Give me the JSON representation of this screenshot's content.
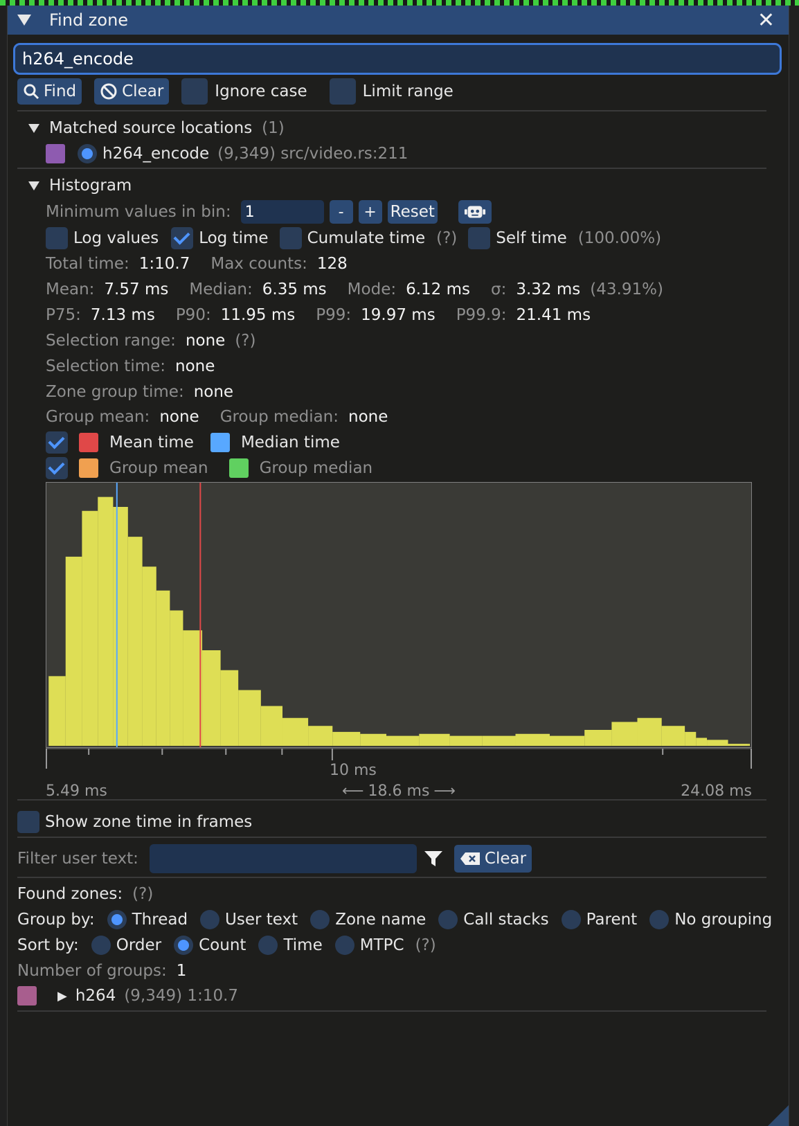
{
  "window": {
    "title": "Find zone"
  },
  "search": {
    "value": "h264_encode"
  },
  "toolbar": {
    "find_label": "Find",
    "clear_label": "Clear",
    "ignore_case_label": "Ignore case",
    "limit_range_label": "Limit range"
  },
  "matched": {
    "header": "Matched source locations",
    "count": "(1)",
    "item": {
      "name": "h264_encode",
      "detail": "(9,349) src/video.rs:211",
      "color": "#8e5bb0"
    }
  },
  "histogram": {
    "header": "Histogram",
    "min_values_label": "Minimum values in bin:",
    "min_values_value": "1",
    "minus_label": "-",
    "plus_label": "+",
    "reset_label": "Reset",
    "options": {
      "log_values": "Log values",
      "log_time": "Log time",
      "cumulate_time": "Cumulate time",
      "help": "(?)",
      "self_time": "Self time",
      "self_time_pct": "(100.00%)"
    },
    "stats": {
      "total_time_label": "Total time:",
      "total_time": "1:10.7",
      "max_counts_label": "Max counts:",
      "max_counts": "128",
      "mean_label": "Mean:",
      "mean": "7.57 ms",
      "median_label": "Median:",
      "median": "6.35 ms",
      "mode_label": "Mode:",
      "mode": "6.12 ms",
      "sigma_label": "σ:",
      "sigma": "3.32 ms",
      "sigma_pct": "(43.91%)",
      "p75_label": "P75:",
      "p75": "7.13 ms",
      "p90_label": "P90:",
      "p90": "11.95 ms",
      "p99_label": "P99:",
      "p99": "19.97 ms",
      "p999_label": "P99.9:",
      "p999": "21.41 ms",
      "selection_range_label": "Selection range:",
      "selection_range": "none",
      "selection_help": "(?)",
      "selection_time_label": "Selection time:",
      "selection_time": "none",
      "zone_group_time_label": "Zone group time:",
      "zone_group_time": "none",
      "group_mean_label": "Group mean:",
      "group_mean": "none",
      "group_median_label": "Group median:",
      "group_median": "none"
    },
    "legend": {
      "mean_time": "Mean time",
      "median_time": "Median time",
      "group_mean": "Group mean",
      "group_median": "Group median",
      "mean_color": "#e04848",
      "median_color": "#58a8ff",
      "group_mean_color": "#f0a050",
      "group_median_color": "#60d060"
    },
    "axis": {
      "min": "5.49 ms",
      "max": "24.08 ms",
      "tick": "10 ms",
      "range": "18.6 ms"
    },
    "bar_color": "#dede55"
  },
  "chart_data": {
    "type": "bar",
    "title": "",
    "xlabel": "",
    "ylabel": "",
    "x_scale": "log",
    "xlim": [
      5.49,
      24.08
    ],
    "ylim": [
      0,
      128
    ],
    "x": [
      5.5,
      5.7,
      5.9,
      6.1,
      6.3,
      6.5,
      6.7,
      6.9,
      7.1,
      7.3,
      7.6,
      7.9,
      8.2,
      8.6,
      9.0,
      9.5,
      10.0,
      10.6,
      11.2,
      12.0,
      12.8,
      13.7,
      14.7,
      15.8,
      17.0,
      18.0,
      19.0,
      20.0,
      21.0,
      21.5,
      22.0,
      23.0,
      24.0
    ],
    "values": [
      35,
      95,
      118,
      125,
      120,
      105,
      90,
      78,
      68,
      58,
      48,
      38,
      28,
      20,
      14,
      10,
      7,
      6,
      5,
      6,
      5,
      5,
      6,
      5,
      8,
      12,
      14,
      10,
      7,
      4,
      3,
      1,
      1
    ],
    "mean": 7.57,
    "median": 6.35
  },
  "zone_frames": {
    "label": "Show zone time in frames"
  },
  "filter": {
    "label": "Filter user text:",
    "placeholder": "",
    "clear_label": "Clear"
  },
  "found": {
    "label": "Found zones:",
    "help": "(?)",
    "group_by_label": "Group by:",
    "group_by": [
      "Thread",
      "User text",
      "Zone name",
      "Call stacks",
      "Parent",
      "No grouping"
    ],
    "sort_by_label": "Sort by:",
    "sort_by": [
      "Order",
      "Count",
      "Time",
      "MTPC"
    ],
    "sort_help": "(?)",
    "groups_label": "Number of groups:",
    "groups_count": "1",
    "group": {
      "name": "h264",
      "detail": "(9,349) 1:10.7",
      "color": "#a85e8e"
    }
  }
}
